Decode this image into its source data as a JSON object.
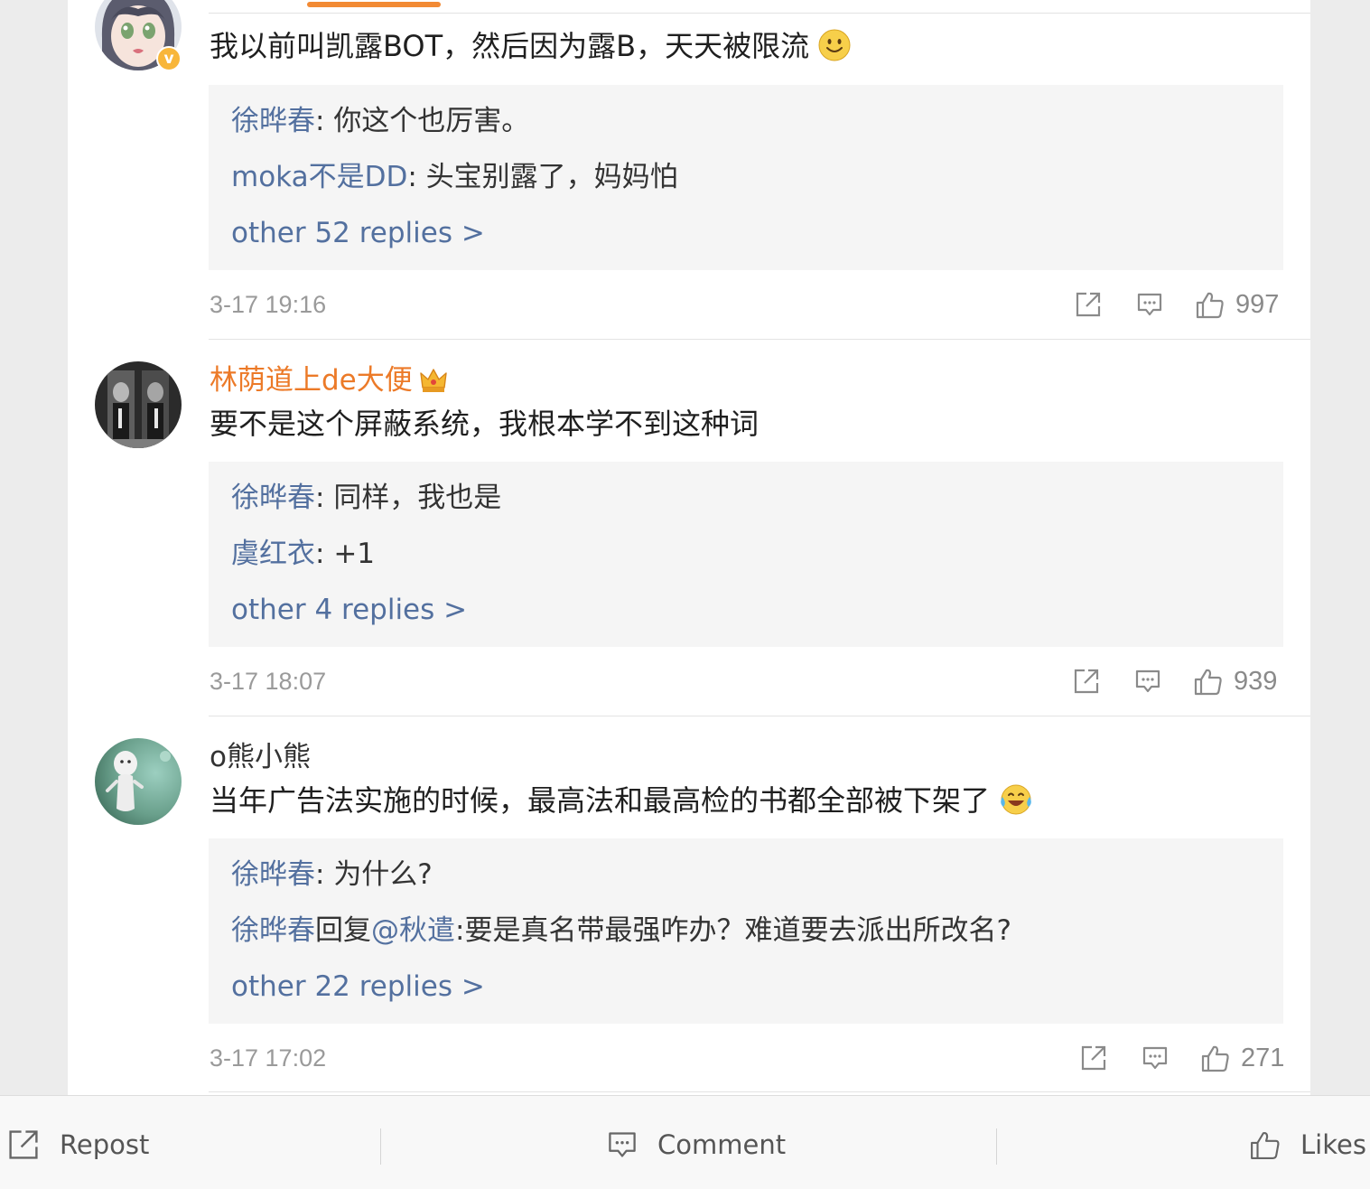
{
  "comments": [
    {
      "username": "",
      "text": "我以前叫凯露BOT，然后因为露B，天天被限流",
      "emoji_icon": "smile-emoji",
      "replies": [
        {
          "name": "徐晔春",
          "sep": ": ",
          "text": "你这个也厉害。"
        },
        {
          "name": "moka不是DD",
          "sep": ": ",
          "text": "头宝别露了，妈妈怕"
        }
      ],
      "more_label": "other 52 replies >",
      "time": "3-17 19:16",
      "likes": "997"
    },
    {
      "username": "林荫道上de大便",
      "badge_icon": "crown-icon",
      "text": "要不是这个屏蔽系统，我根本学不到这种词",
      "replies": [
        {
          "name": "徐晔春",
          "sep": ": ",
          "text": "同样，我也是"
        },
        {
          "name": "虞红衣",
          "sep": ": ",
          "text": "+1"
        }
      ],
      "more_label": "other 4 replies >",
      "time": "3-17 18:07",
      "likes": "939"
    },
    {
      "username": "o熊小熊",
      "text": "当年广告法实施的时候，最高法和最高检的书都全部被下架了",
      "emoji_icon": "laugh-cry-emoji",
      "replies": [
        {
          "name": "徐晔春",
          "sep": ": ",
          "text": "为什么?"
        },
        {
          "name": "徐晔春",
          "mid": "回复",
          "mention": "@秋遣",
          "sep": ":",
          "text": "要是真名带最强咋办？难道要去派出所改名?"
        }
      ],
      "more_label": "other 22 replies >",
      "time": "3-17 17:02",
      "likes": "271"
    }
  ],
  "bottom_bar": {
    "repost_label": "Repost",
    "comment_label": "Comment",
    "likes_label": "Likes"
  },
  "colors": {
    "link_blue": "#53709f",
    "name_orange": "#ec7a28",
    "accent_orange": "#f28a34",
    "reply_bg": "#f5f5f5"
  }
}
